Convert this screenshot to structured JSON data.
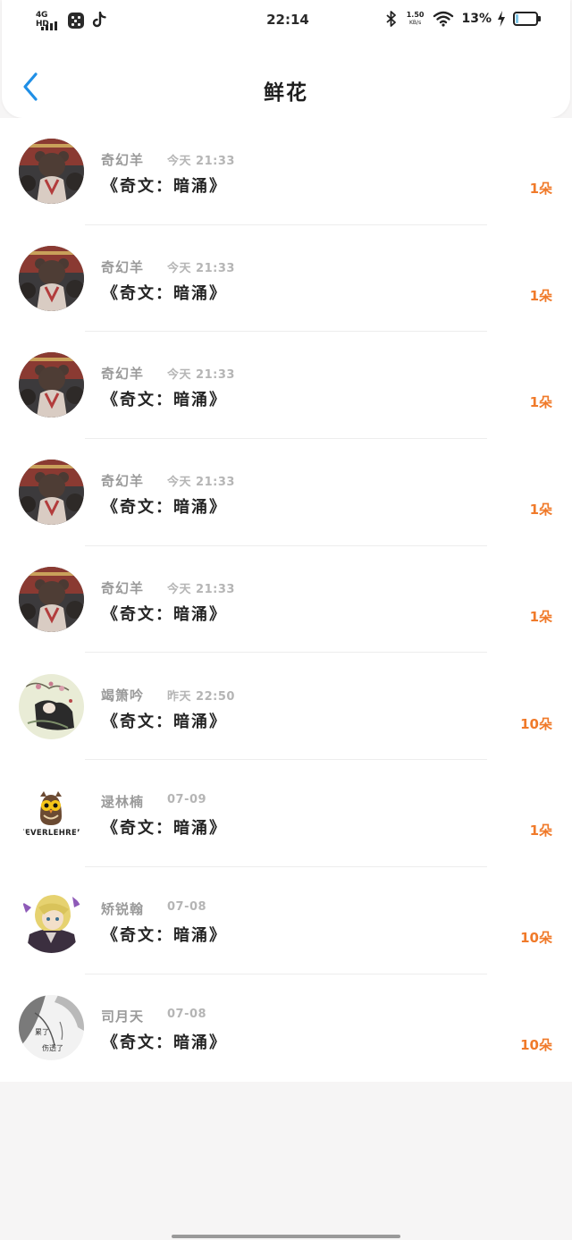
{
  "status_bar": {
    "network": "4G HD",
    "time": "22:14",
    "speed_value": "1.50",
    "speed_unit": "KB/s",
    "battery_percent": "13%",
    "battery_level": 0.13,
    "icons": [
      "signal-icon",
      "app-icon",
      "tiktok-icon",
      "bluetooth-icon",
      "wifi-icon",
      "charging-icon",
      "battery-icon"
    ]
  },
  "nav": {
    "back_icon": "chevron-left-icon",
    "title": "鲜花"
  },
  "colors": {
    "accent_blue": "#1f8fe6",
    "flower_orange": "#f07a2a",
    "name_gray": "#9a9a9a",
    "title_dark": "#242424"
  },
  "records": [
    {
      "name": "奇幻羊",
      "time": "今天 21:33",
      "book": "《奇文：暗涌》",
      "flowers": "1朵",
      "avatar": "bear-avatar"
    },
    {
      "name": "奇幻羊",
      "time": "今天 21:33",
      "book": "《奇文：暗涌》",
      "flowers": "1朵",
      "avatar": "bear-avatar"
    },
    {
      "name": "奇幻羊",
      "time": "今天 21:33",
      "book": "《奇文：暗涌》",
      "flowers": "1朵",
      "avatar": "bear-avatar"
    },
    {
      "name": "奇幻羊",
      "time": "今天 21:33",
      "book": "《奇文：暗涌》",
      "flowers": "1朵",
      "avatar": "bear-avatar"
    },
    {
      "name": "奇幻羊",
      "time": "今天 21:33",
      "book": "《奇文：暗涌》",
      "flowers": "1朵",
      "avatar": "bear-avatar"
    },
    {
      "name": "竭箫吟",
      "time": "昨天 22:50",
      "book": "《奇文：暗涌》",
      "flowers": "10朵",
      "avatar": "painting-avatar"
    },
    {
      "name": "逯林楠",
      "time": "07-09",
      "book": "《奇文：暗涌》",
      "flowers": "1朵",
      "avatar": "owl-avatar",
      "avatar_text": "NEVERLEHREN"
    },
    {
      "name": "矫锐翰",
      "time": "07-08",
      "book": "《奇文：暗涌》",
      "flowers": "10朵",
      "avatar": "anime-avatar"
    },
    {
      "name": "司月天",
      "time": "07-08",
      "book": "《奇文：暗涌》",
      "flowers": "10朵",
      "avatar": "sketch-avatar",
      "avatar_text": [
        "累了",
        "伤透了"
      ]
    }
  ]
}
